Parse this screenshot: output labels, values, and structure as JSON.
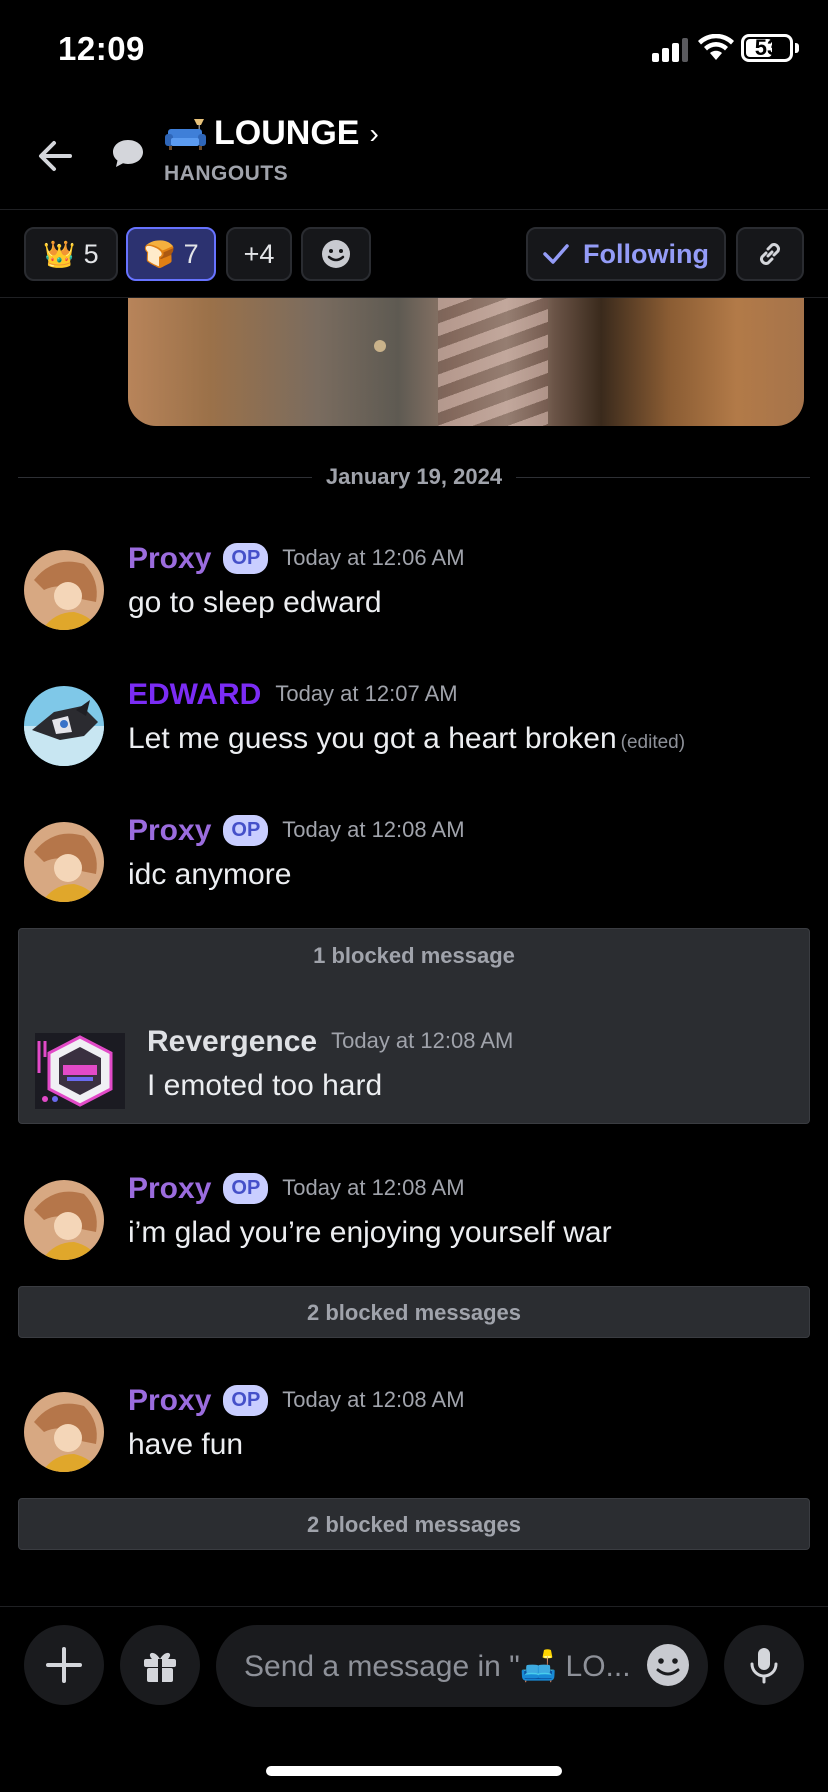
{
  "status": {
    "time": "12:09",
    "battery": "53"
  },
  "header": {
    "title": "LOUNGE",
    "subtitle": "HANGOUTS"
  },
  "reactions": [
    {
      "emoji": "👑",
      "count": "5"
    },
    {
      "emoji": "🍞",
      "count": "7"
    },
    {
      "label": "+4"
    }
  ],
  "follow": {
    "label": "Following"
  },
  "date_divider": "January 19, 2024",
  "messages": [
    {
      "author": "Proxy",
      "badge": "OP",
      "time": "Today at 12:06 AM",
      "text": "go to sleep edward"
    },
    {
      "author": "EDWARD",
      "time": "Today at 12:07 AM",
      "text": "Let me guess you got a heart broken",
      "edited": "(edited)"
    },
    {
      "author": "Proxy",
      "badge": "OP",
      "time": "Today at 12:08 AM",
      "text": "idc anymore"
    },
    {
      "author": "Proxy",
      "badge": "OP",
      "time": "Today at 12:08 AM",
      "text": "i’m glad you’re enjoying yourself war"
    },
    {
      "author": "Proxy",
      "badge": "OP",
      "time": "Today at 12:08 AM",
      "text": "have fun"
    }
  ],
  "blocked": [
    {
      "label": "1 blocked message",
      "revealed": {
        "author": "Revergence",
        "time": "Today at 12:08 AM",
        "text": "I emoted too hard"
      }
    },
    {
      "label": "2 blocked messages"
    },
    {
      "label": "2 blocked messages"
    }
  ],
  "composer": {
    "placeholder": "Send a message in \"🛋️ LO..."
  },
  "colors": {
    "accent": "#5865f2",
    "proxy": "#9b6cde",
    "edward": "#7b2cf5",
    "background": "#000000"
  }
}
